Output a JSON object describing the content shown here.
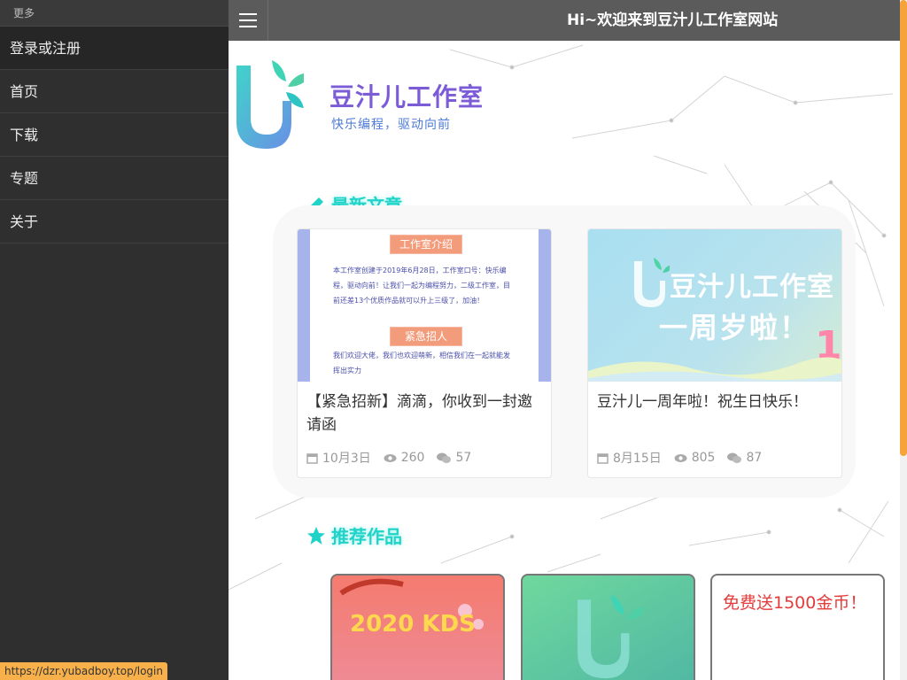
{
  "sidebar": {
    "header": "更多",
    "items": [
      {
        "label": "登录或注册"
      },
      {
        "label": "首页"
      },
      {
        "label": "下载"
      },
      {
        "label": "专题"
      },
      {
        "label": "关于"
      }
    ]
  },
  "topbar": {
    "menu_icon": "menu-icon",
    "title": "Hi~欢迎来到豆汁儿工作室网站"
  },
  "brand": {
    "name": "豆汁儿工作室",
    "slogan": "快乐编程，驱动向前"
  },
  "latest": {
    "title": "最新文章",
    "icon": "pencil-icon",
    "articles": [
      {
        "title": "【紧急招新】滴滴，你收到一封邀请函",
        "date": "10月3日",
        "views": "260",
        "comments": "57",
        "thumb": {
          "tag1": "工作室介绍",
          "para1": "本工作室创建于2019年6月28日，工作室口号：快乐编程，驱动向前！让我们一起为编程努力，二级工作室，目前还差13个优质作品就可以升上三级了，加油！",
          "tag2": "紧急招人",
          "para2": "我们欢迎大佬，我们也欢迎萌新，相信我们在一起就能发挥出实力"
        }
      },
      {
        "title": "豆汁儿一周年啦！祝生日快乐！",
        "date": "8月15日",
        "views": "805",
        "comments": "87",
        "thumb": {
          "line1": "豆汁儿工作室",
          "line2": "一周岁啦！",
          "number": "1"
        }
      }
    ]
  },
  "works": {
    "title": "推荐作品",
    "icon": "star-icon",
    "items": [
      {
        "text": "2020 KDS"
      },
      {
        "text": ""
      },
      {
        "text": "免费送1500金币！"
      }
    ]
  },
  "status": {
    "url": "https://dzr.yubadboy.top/login"
  },
  "colors": {
    "sidebar_bg": "#2f2f2f",
    "topbar_bg": "#5b5b5b",
    "accent_teal": "#1fd3c8",
    "brand_purple": "#7b5bd6",
    "scrollbar": "#f5a33a"
  }
}
